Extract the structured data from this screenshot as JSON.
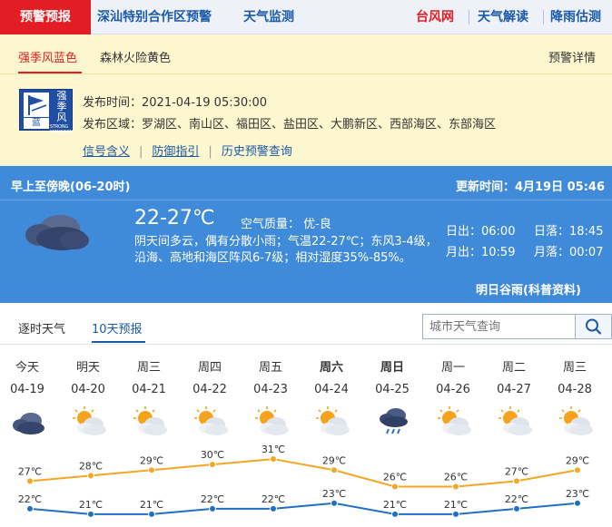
{
  "topnav": {
    "alert_tab": "预警预报",
    "links": [
      "深汕特别合作区预警",
      "天气监测"
    ],
    "right_links": [
      "台风网",
      "天气解读",
      "降雨估测"
    ]
  },
  "warning": {
    "tabs": [
      "强季风蓝色",
      "森林火险黄色"
    ],
    "detail_link": "预警详情",
    "signal": {
      "color_label": "蓝",
      "name_vertical": "强季风",
      "english": "STRONG MONSOON",
      "color": "#1f4ea3"
    },
    "issue_time": "发布时间：2021-04-19 05:30:00",
    "areas": "发布区域：罗湖区、南山区、福田区、盐田区、大鹏新区、西部海区、东部海区",
    "links": [
      "信号含义",
      "防御指引",
      "历史预警查询"
    ]
  },
  "forecast": {
    "period": "早上至傍晚(06-20时)",
    "update": "更新时间：4月19日 05:46",
    "temp": "22-27℃",
    "air_quality": "空气质量： 优-良",
    "description": "阴天间多云，偶有分散小雨；气温22-27℃；东风3-4级，沿海、高地和海区阵风6-7级；相对湿度35%-85%。",
    "sunrise": "日出：06:00",
    "sunset": "日落：18:45",
    "moonrise": "月出：10:59",
    "moonset": "月落：00:07",
    "tomorrow": "明日谷雨(科普资料)"
  },
  "tabs": [
    "逐时天气",
    "10天预报"
  ],
  "search": {
    "placeholder": "城市天气查询"
  },
  "days": [
    {
      "week": "今天",
      "date": "04-19",
      "bold": false,
      "icon": "overcast-icon"
    },
    {
      "week": "明天",
      "date": "04-20",
      "bold": false,
      "icon": "partly-cloudy-icon"
    },
    {
      "week": "周三",
      "date": "04-21",
      "bold": false,
      "icon": "partly-cloudy-icon"
    },
    {
      "week": "周四",
      "date": "04-22",
      "bold": false,
      "icon": "partly-cloudy-icon"
    },
    {
      "week": "周五",
      "date": "04-23",
      "bold": false,
      "icon": "partly-cloudy-icon"
    },
    {
      "week": "周六",
      "date": "04-24",
      "bold": true,
      "icon": "partly-cloudy-icon"
    },
    {
      "week": "周日",
      "date": "04-25",
      "bold": true,
      "icon": "rain-icon"
    },
    {
      "week": "周一",
      "date": "04-26",
      "bold": false,
      "icon": "partly-cloudy-icon"
    },
    {
      "week": "周二",
      "date": "04-27",
      "bold": false,
      "icon": "partly-cloudy-icon"
    },
    {
      "week": "周三",
      "date": "04-28",
      "bold": false,
      "icon": "partly-cloudy-icon"
    }
  ],
  "chart_data": {
    "type": "line",
    "categories": [
      "04-19",
      "04-20",
      "04-21",
      "04-22",
      "04-23",
      "04-24",
      "04-25",
      "04-26",
      "04-27",
      "04-28"
    ],
    "series": [
      {
        "values": [
          27,
          28,
          29,
          30,
          31,
          29,
          26,
          26,
          27,
          29
        ],
        "color": "#f5a623",
        "unit": "℃"
      },
      {
        "values": [
          22,
          21,
          21,
          22,
          22,
          23,
          21,
          21,
          22,
          23
        ],
        "color": "#1f6fc6",
        "unit": "℃"
      }
    ]
  }
}
